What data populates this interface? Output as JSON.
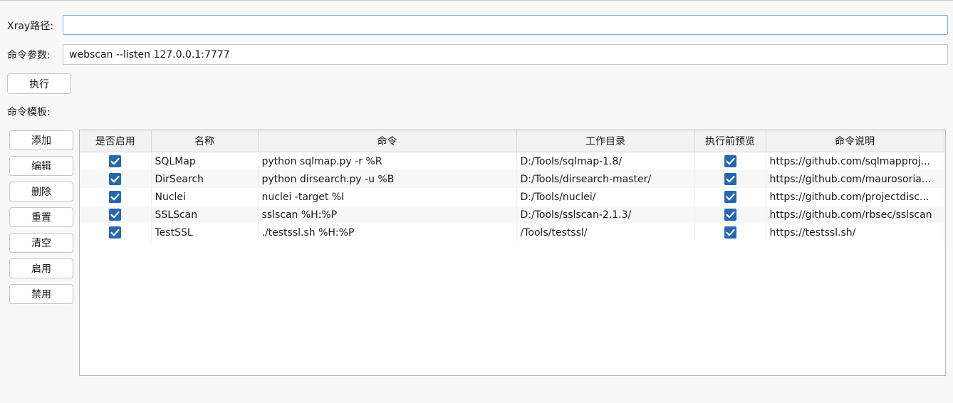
{
  "form": {
    "xray_path_label": "Xray路径:",
    "xray_path_value": "",
    "cmd_args_label": "命令参数:",
    "cmd_args_value": "webscan --listen 127.0.0.1:7777",
    "execute_label": "执行",
    "templates_label": "命令模板:"
  },
  "side_buttons": {
    "add": "添加",
    "edit": "编辑",
    "delete": "删除",
    "reset": "重置",
    "clear": "清空",
    "enable": "启用",
    "disable": "禁用"
  },
  "table": {
    "columns": [
      "是否启用",
      "名称",
      "命令",
      "工作目录",
      "执行前预览",
      "命令说明"
    ],
    "rows": [
      {
        "enabled": true,
        "name": "SQLMap",
        "command": "python sqlmap.py -r %R",
        "workdir": "D:/Tools/sqlmap-1.8/",
        "preview": true,
        "desc": "https://github.com/sqlmapproj..."
      },
      {
        "enabled": true,
        "name": "DirSearch",
        "command": "python dirsearch.py -u %B",
        "workdir": "D:/Tools/dirsearch-master/",
        "preview": true,
        "desc": "https://github.com/maurosoria..."
      },
      {
        "enabled": true,
        "name": "Nuclei",
        "command": "nuclei -target %I",
        "workdir": "D:/Tools/nuclei/",
        "preview": true,
        "desc": "https://github.com/projectdisc..."
      },
      {
        "enabled": true,
        "name": "SSLScan",
        "command": "sslscan %H:%P",
        "workdir": "D:/Tools/sslscan-2.1.3/",
        "preview": true,
        "desc": "https://github.com/rbsec/sslscan"
      },
      {
        "enabled": true,
        "name": "TestSSL",
        "command": "./testssl.sh %H:%P",
        "workdir": "/Tools/testssl/",
        "preview": true,
        "desc": "https://testssl.sh/"
      }
    ]
  },
  "colors": {
    "checkbox_fill": "#2467b2",
    "focus_border": "#7aaee3",
    "background": "#f8f8f8"
  },
  "icons": {
    "checkbox": "checkmark-icon"
  }
}
